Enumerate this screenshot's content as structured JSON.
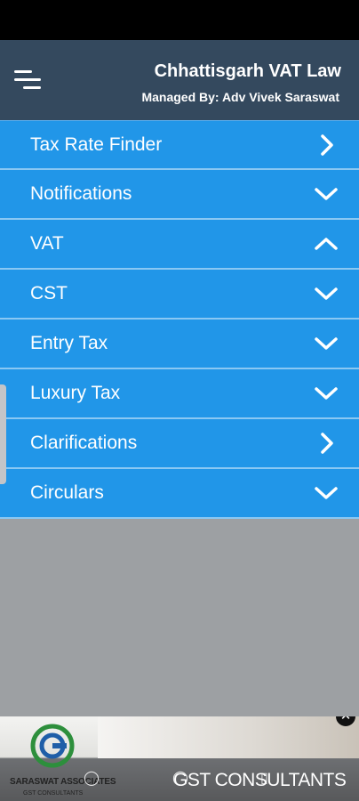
{
  "header": {
    "title": "Chhattisgarh VAT Law",
    "subtitle": "Managed By: Adv Vivek Saraswat",
    "menu_icon": "hamburger-icon"
  },
  "menu": {
    "items": [
      {
        "label": "Tax Rate Finder",
        "icon": "chevron-right-icon"
      },
      {
        "label": "Notifications",
        "icon": "chevron-down-icon"
      },
      {
        "label": "VAT",
        "icon": "chevron-up-icon"
      },
      {
        "label": "CST",
        "icon": "chevron-down-icon"
      },
      {
        "label": "Entry Tax",
        "icon": "chevron-down-icon"
      },
      {
        "label": "Luxury Tax",
        "icon": "chevron-down-icon"
      },
      {
        "label": "Clarifications",
        "icon": "chevron-right-icon"
      },
      {
        "label": "Circulars",
        "icon": "chevron-down-icon"
      }
    ]
  },
  "ad": {
    "brand": "SARASWAT ASSOCIATES",
    "tagline_small": "GST CONSULTANTS",
    "tagline": "GST CONSULTANTS",
    "close_icon": "close-icon"
  },
  "colors": {
    "header_bg": "#34495e",
    "menu_item_bg": "#2196e8",
    "content_bg": "#9da0a3"
  }
}
